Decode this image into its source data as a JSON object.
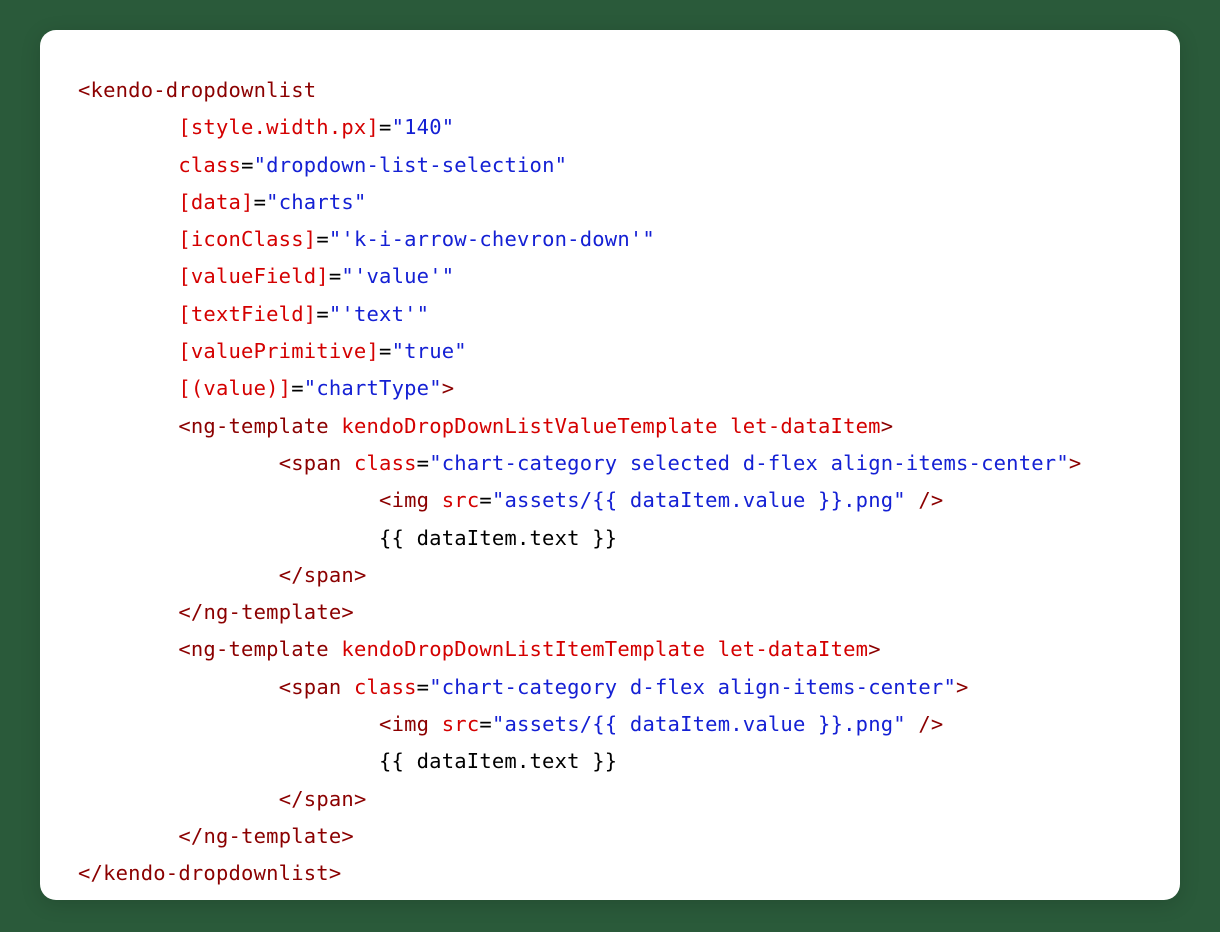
{
  "code": {
    "type": "html-template",
    "language": "angular-template",
    "lines": [
      {
        "indent": 0,
        "tokens": [
          {
            "t": "punct-tag",
            "v": "<"
          },
          {
            "t": "tag",
            "v": "kendo-dropdownlist"
          }
        ]
      },
      {
        "indent": 2,
        "tokens": [
          {
            "t": "attr",
            "v": "[style.width.px]"
          },
          {
            "t": "txt",
            "v": "="
          },
          {
            "t": "val",
            "v": "\"140\""
          }
        ]
      },
      {
        "indent": 2,
        "tokens": [
          {
            "t": "attr",
            "v": "class"
          },
          {
            "t": "txt",
            "v": "="
          },
          {
            "t": "val",
            "v": "\"dropdown-list-selection\""
          }
        ]
      },
      {
        "indent": 2,
        "tokens": [
          {
            "t": "attr",
            "v": "[data]"
          },
          {
            "t": "txt",
            "v": "="
          },
          {
            "t": "val",
            "v": "\"charts\""
          }
        ]
      },
      {
        "indent": 2,
        "tokens": [
          {
            "t": "attr",
            "v": "[iconClass]"
          },
          {
            "t": "txt",
            "v": "="
          },
          {
            "t": "val",
            "v": "\"'k-i-arrow-chevron-down'\""
          }
        ]
      },
      {
        "indent": 2,
        "tokens": [
          {
            "t": "attr",
            "v": "[valueField]"
          },
          {
            "t": "txt",
            "v": "="
          },
          {
            "t": "val",
            "v": "\"'value'\""
          }
        ]
      },
      {
        "indent": 2,
        "tokens": [
          {
            "t": "attr",
            "v": "[textField]"
          },
          {
            "t": "txt",
            "v": "="
          },
          {
            "t": "val",
            "v": "\"'text'\""
          }
        ]
      },
      {
        "indent": 2,
        "tokens": [
          {
            "t": "attr",
            "v": "[valuePrimitive]"
          },
          {
            "t": "txt",
            "v": "="
          },
          {
            "t": "val",
            "v": "\"true\""
          }
        ]
      },
      {
        "indent": 2,
        "tokens": [
          {
            "t": "attr",
            "v": "[(value)]"
          },
          {
            "t": "txt",
            "v": "="
          },
          {
            "t": "val",
            "v": "\"chartType\""
          },
          {
            "t": "punct-tag",
            "v": ">"
          }
        ]
      },
      {
        "indent": 2,
        "tokens": [
          {
            "t": "punct-tag",
            "v": "<"
          },
          {
            "t": "tag",
            "v": "ng-template"
          },
          {
            "t": "txt",
            "v": " "
          },
          {
            "t": "attr",
            "v": "kendoDropDownListValueTemplate"
          },
          {
            "t": "txt",
            "v": " "
          },
          {
            "t": "attr",
            "v": "let-dataItem"
          },
          {
            "t": "punct-tag",
            "v": ">"
          }
        ]
      },
      {
        "indent": 4,
        "tokens": [
          {
            "t": "punct-tag",
            "v": "<"
          },
          {
            "t": "tag",
            "v": "span"
          },
          {
            "t": "txt",
            "v": " "
          },
          {
            "t": "attr",
            "v": "class"
          },
          {
            "t": "txt",
            "v": "="
          },
          {
            "t": "val",
            "v": "\"chart-category selected d-flex align-items-center\""
          },
          {
            "t": "punct-tag",
            "v": ">"
          }
        ]
      },
      {
        "indent": 6,
        "tokens": [
          {
            "t": "punct-tag",
            "v": "<"
          },
          {
            "t": "tag",
            "v": "img"
          },
          {
            "t": "txt",
            "v": " "
          },
          {
            "t": "attr",
            "v": "src"
          },
          {
            "t": "txt",
            "v": "="
          },
          {
            "t": "val",
            "v": "\"assets/{{ dataItem.value }}.png\""
          },
          {
            "t": "txt",
            "v": " "
          },
          {
            "t": "punct-tag",
            "v": "/>"
          }
        ]
      },
      {
        "indent": 6,
        "tokens": [
          {
            "t": "txt",
            "v": "{{ dataItem.text }}"
          }
        ]
      },
      {
        "indent": 4,
        "tokens": [
          {
            "t": "punct-tag",
            "v": "</"
          },
          {
            "t": "tag",
            "v": "span"
          },
          {
            "t": "punct-tag",
            "v": ">"
          }
        ]
      },
      {
        "indent": 2,
        "tokens": [
          {
            "t": "punct-tag",
            "v": "</"
          },
          {
            "t": "tag",
            "v": "ng-template"
          },
          {
            "t": "punct-tag",
            "v": ">"
          }
        ]
      },
      {
        "indent": 2,
        "tokens": [
          {
            "t": "punct-tag",
            "v": "<"
          },
          {
            "t": "tag",
            "v": "ng-template"
          },
          {
            "t": "txt",
            "v": " "
          },
          {
            "t": "attr",
            "v": "kendoDropDownListItemTemplate"
          },
          {
            "t": "txt",
            "v": " "
          },
          {
            "t": "attr",
            "v": "let-dataItem"
          },
          {
            "t": "punct-tag",
            "v": ">"
          }
        ]
      },
      {
        "indent": 4,
        "tokens": [
          {
            "t": "punct-tag",
            "v": "<"
          },
          {
            "t": "tag",
            "v": "span"
          },
          {
            "t": "txt",
            "v": " "
          },
          {
            "t": "attr",
            "v": "class"
          },
          {
            "t": "txt",
            "v": "="
          },
          {
            "t": "val",
            "v": "\"chart-category d-flex align-items-center\""
          },
          {
            "t": "punct-tag",
            "v": ">"
          }
        ]
      },
      {
        "indent": 6,
        "tokens": [
          {
            "t": "punct-tag",
            "v": "<"
          },
          {
            "t": "tag",
            "v": "img"
          },
          {
            "t": "txt",
            "v": " "
          },
          {
            "t": "attr",
            "v": "src"
          },
          {
            "t": "txt",
            "v": "="
          },
          {
            "t": "val",
            "v": "\"assets/{{ dataItem.value }}.png\""
          },
          {
            "t": "txt",
            "v": " "
          },
          {
            "t": "punct-tag",
            "v": "/>"
          }
        ]
      },
      {
        "indent": 6,
        "tokens": [
          {
            "t": "txt",
            "v": "{{ dataItem.text }}"
          }
        ]
      },
      {
        "indent": 4,
        "tokens": [
          {
            "t": "punct-tag",
            "v": "</"
          },
          {
            "t": "tag",
            "v": "span"
          },
          {
            "t": "punct-tag",
            "v": ">"
          }
        ]
      },
      {
        "indent": 2,
        "tokens": [
          {
            "t": "punct-tag",
            "v": "</"
          },
          {
            "t": "tag",
            "v": "ng-template"
          },
          {
            "t": "punct-tag",
            "v": ">"
          }
        ]
      },
      {
        "indent": 0,
        "tokens": [
          {
            "t": "punct-tag",
            "v": "</"
          },
          {
            "t": "tag",
            "v": "kendo-dropdownlist"
          },
          {
            "t": "punct-tag",
            "v": ">"
          }
        ]
      }
    ]
  }
}
